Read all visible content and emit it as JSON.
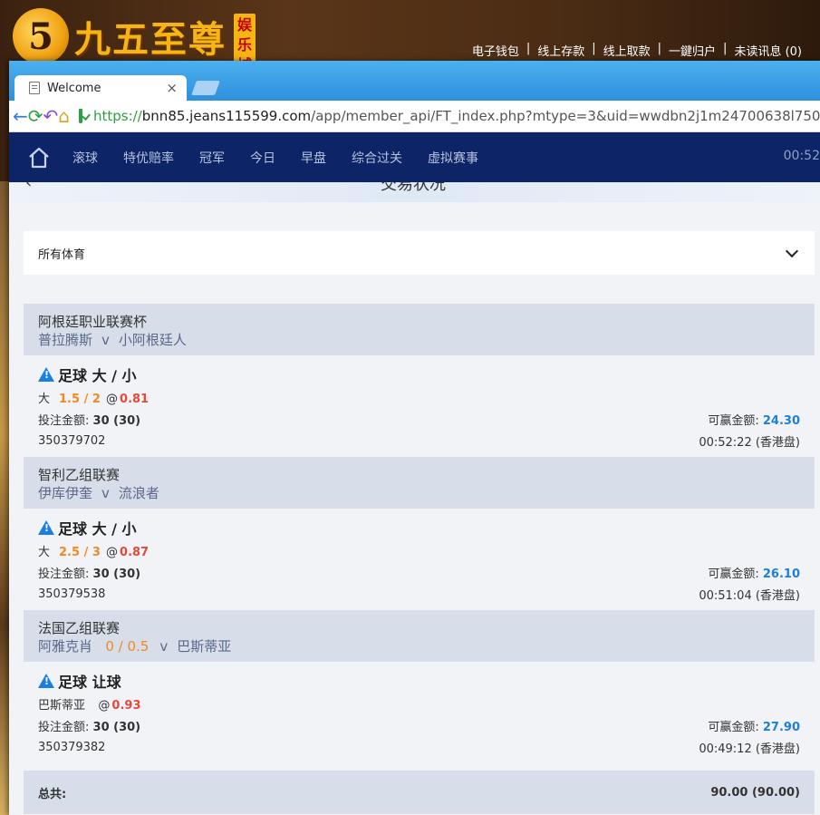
{
  "site": {
    "logo_mark": "5",
    "logo_name": "九五至尊",
    "logo_tag": "娱乐城",
    "top_links": [
      "电子钱包",
      "线上存款",
      "线上取款",
      "一鍵归户",
      "未读讯息 (0)"
    ]
  },
  "browser": {
    "tab_title": "Welcome",
    "tab_close": "×",
    "url_scheme": "https://",
    "url_host": "bnn85.jeans115599.com",
    "url_path": "/app/member_api/FT_index.php?mtype=3&uid=wwdbn2j1m24700638l750"
  },
  "nav": {
    "items": [
      "滚球",
      "特优赔率",
      "冠军",
      "今日",
      "早盘",
      "综合过关",
      "虚拟赛事"
    ],
    "time": "00:52"
  },
  "subheader": {
    "title_clipped": "交易状况",
    "back": "‹"
  },
  "filter": {
    "label": "所有体育"
  },
  "bets": [
    {
      "league": "阿根廷职业联赛杯",
      "home": "普拉腾斯",
      "vs": "v",
      "away": "小阿根廷人",
      "handicap": "",
      "market": "足球 大 / 小",
      "pick": "大",
      "line": "1.5 / 2",
      "at": "@",
      "odds": "0.81",
      "stake_label": "投注金额:",
      "stake": "30 (30)",
      "win_label": "可赢金额:",
      "win": "24.30",
      "ticket": "350379702",
      "time": "00:52:22 (香港盘)"
    },
    {
      "league": "智利乙组联赛",
      "home": "伊库伊奎",
      "vs": "v",
      "away": "流浪者",
      "handicap": "",
      "market": "足球 大 / 小",
      "pick": "大",
      "line": "2.5 / 3",
      "at": "@",
      "odds": "0.87",
      "stake_label": "投注金额:",
      "stake": "30 (30)",
      "win_label": "可赢金额:",
      "win": "26.10",
      "ticket": "350379538",
      "time": "00:51:04 (香港盘)"
    },
    {
      "league": "法国乙组联赛",
      "home": "阿雅克肖",
      "vs": "v",
      "away": "巴斯蒂亚",
      "handicap": "0 / 0.5",
      "market": "足球 让球",
      "pick": "巴斯蒂亚",
      "line": "",
      "at": "@",
      "odds": "0.93",
      "stake_label": "投注金额:",
      "stake": "30 (30)",
      "win_label": "可赢金额:",
      "win": "27.90",
      "ticket": "350379382",
      "time": "00:49:12 (香港盘)"
    }
  ],
  "total": {
    "label": "总共:",
    "value": "90.00 (90.00)"
  },
  "colors": {
    "nav_bg": "#0d2466",
    "accent_orange": "#f08a24",
    "odds_red": "#e24a3a",
    "win_blue": "#1f7fd6"
  }
}
